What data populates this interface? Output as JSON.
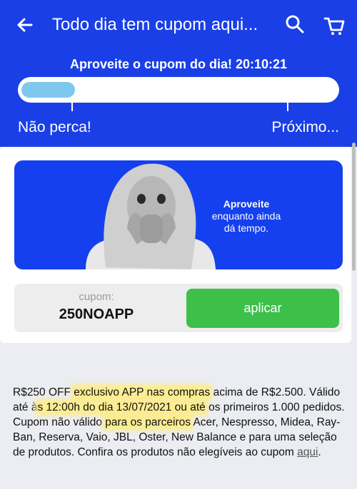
{
  "header": {
    "title": "Todo dia tem cupom aqui...",
    "back_icon": "arrow-left-icon",
    "search_icon": "search-icon",
    "cart_icon": "cart-icon",
    "color": "#1a3fe6"
  },
  "timer": {
    "text": "Aproveite o cupom do dia! 20:10:21",
    "progress_fraction": 0.17,
    "left_label": "Não perca!",
    "right_label": "Próximo..."
  },
  "banner": {
    "title": "Aproveite",
    "subtitle_line1": "enquanto ainda",
    "subtitle_line2": "dá tempo."
  },
  "coupon": {
    "label": "cupom:",
    "code": "250NOAPP",
    "apply_label": "aplicar",
    "apply_color": "#3cc04a"
  },
  "description": {
    "p1": "R$250 OFF ",
    "p2": "exclusivo APP nas compras",
    "p3": " acima de R$2.500. Válido até à",
    "p4": "s 12:00h do dia 13/07/2021 ou até",
    "p5": " os primeiros 1.000 pedidos.  Cupom não válido ",
    "p6": "para os parceiros",
    "p7": " Acer, Nespresso, Midea, Ray-Ban, Reserva, Vaio, JBL, Oster, New Balance e para uma seleção de produtos. Confira os produtos não elegíveis ao cupom ",
    "link": "aqui",
    "p8": "."
  }
}
